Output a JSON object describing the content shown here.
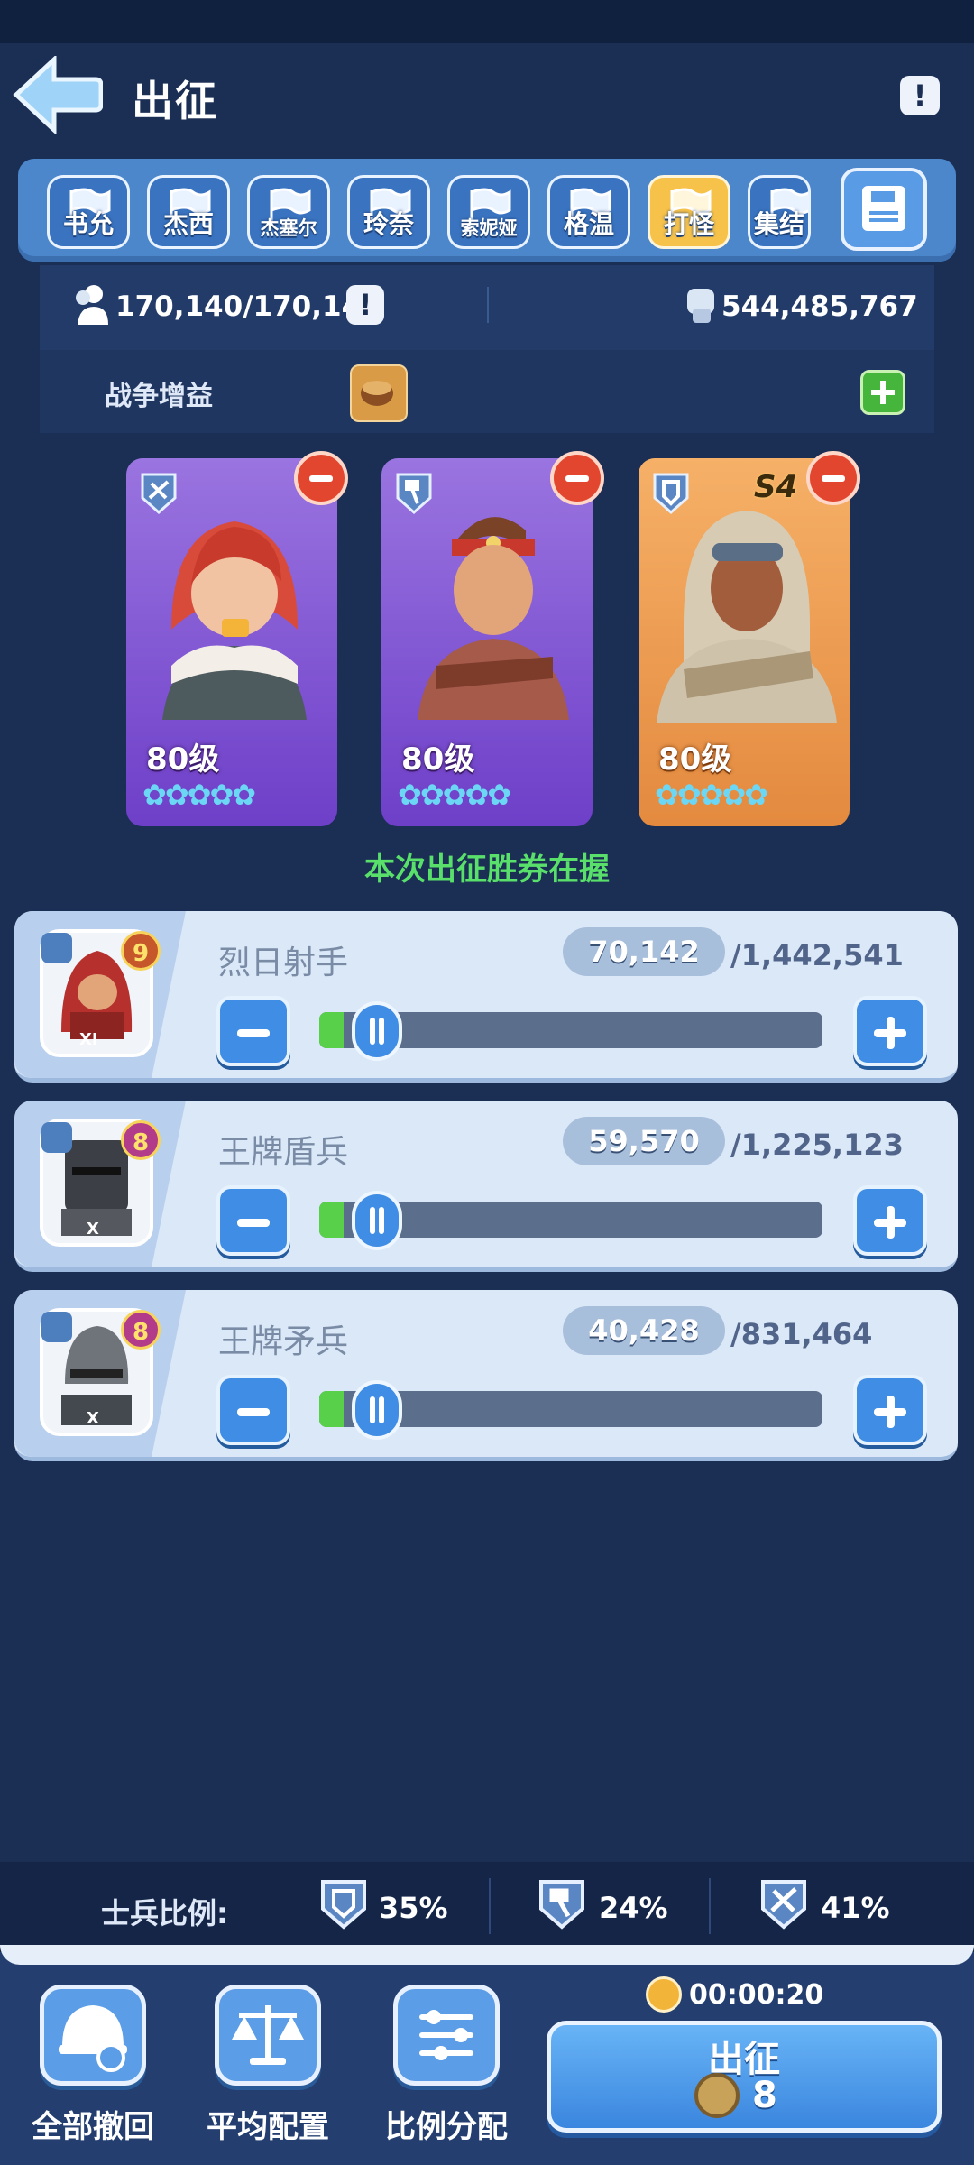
{
  "header": {
    "title": "出征",
    "info_icon": "exclamation-icon",
    "back_icon": "arrow-left-icon"
  },
  "tabs": [
    {
      "label": "书允",
      "active": false
    },
    {
      "label": "杰西",
      "active": false
    },
    {
      "label": "杰塞尔",
      "active": false
    },
    {
      "label": "玲奈",
      "active": false
    },
    {
      "label": "索妮娅",
      "active": false
    },
    {
      "label": "格温",
      "active": false
    },
    {
      "label": "打怪",
      "active": true
    },
    {
      "label": "集结",
      "active": false
    }
  ],
  "stats": {
    "troops": "170,140/170,140",
    "power": "544,485,767"
  },
  "buff": {
    "label": "战争增益"
  },
  "heroes": [
    {
      "level": "80级",
      "stars": "✿✿✿✿✿",
      "type_icon": "crossbow-icon"
    },
    {
      "level": "80级",
      "stars": "✿✿✿✿✿",
      "type_icon": "hammer-icon"
    },
    {
      "level": "80级",
      "stars": "✿✿✿✿✿",
      "type_icon": "shield-icon",
      "season": "S4"
    }
  ],
  "victory_text": "本次出征胜券在握",
  "troops": [
    {
      "name": "烈日射手",
      "count": "70,142",
      "max": "/1,442,541",
      "rank": "9",
      "tier": "XI",
      "fill_percent": 4.9
    },
    {
      "name": "王牌盾兵",
      "count": "59,570",
      "max": "/1,225,123",
      "rank": "8",
      "tier": "X",
      "fill_percent": 4.9
    },
    {
      "name": "王牌矛兵",
      "count": "40,428",
      "max": "/831,464",
      "rank": "8",
      "tier": "X",
      "fill_percent": 4.9
    }
  ],
  "ratio": {
    "label": "士兵比例:",
    "shield": "35%",
    "spear": "24%",
    "archer": "41%"
  },
  "footer": {
    "recall_all": "全部撤回",
    "average": "平均配置",
    "ratio_assign": "比例分配",
    "timer": "00:00:20",
    "march_label": "出征",
    "march_cost": "8"
  },
  "colors": {
    "accent": "#3f8de4",
    "active_tab": "#f7c24a",
    "victory": "#59e06b",
    "remove": "#e2462f"
  }
}
